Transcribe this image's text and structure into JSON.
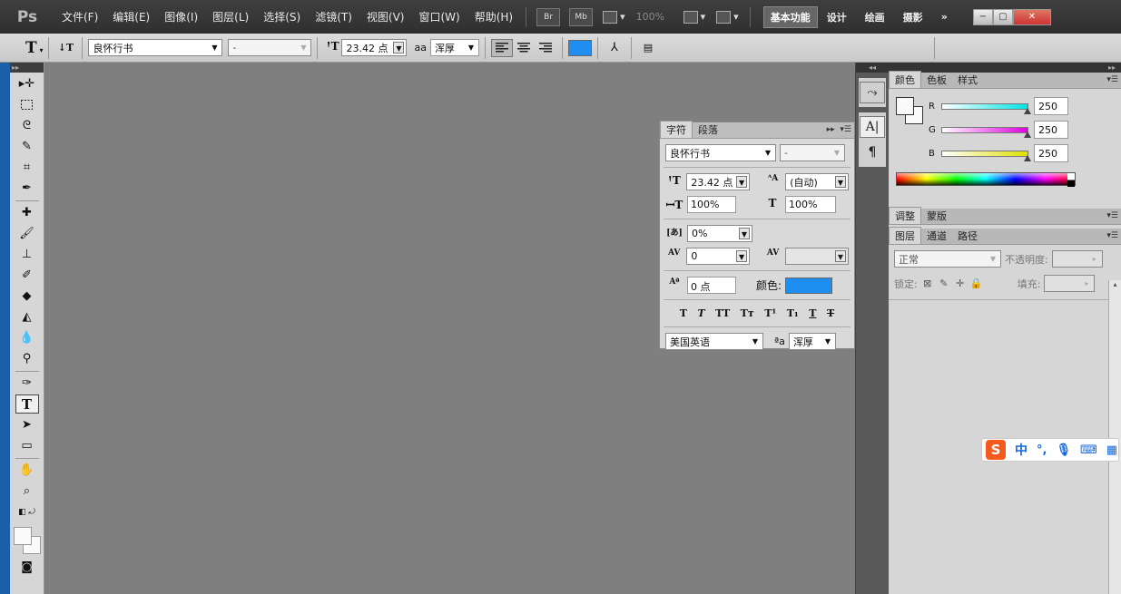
{
  "app": {
    "logo": "Ps"
  },
  "menu": [
    "文件(F)",
    "编辑(E)",
    "图像(I)",
    "图层(L)",
    "选择(S)",
    "滤镜(T)",
    "视图(V)",
    "窗口(W)",
    "帮助(H)"
  ],
  "menubar_tools": {
    "bridge": "Br",
    "minibridge": "Mb",
    "zoom": "100%"
  },
  "workspaces": {
    "active": "基本功能",
    "items": [
      "设计",
      "绘画",
      "摄影"
    ],
    "more": "»"
  },
  "window_controls": {
    "minimize": "−",
    "restore": "▢",
    "close": "✕"
  },
  "options_bar": {
    "font_family": "良怀行书",
    "font_style": "-",
    "font_size": "23.42 点",
    "aa_label": "aa",
    "anti_alias": "浑厚",
    "text_color": "#1e8ff0"
  },
  "character_panel": {
    "tabs": [
      "字符",
      "段落"
    ],
    "font_family": "良怀行书",
    "font_style": "-",
    "font_size": "23.42 点",
    "leading": "(自动)",
    "vertical_scale": "100%",
    "horizontal_scale": "100%",
    "tsume": "0%",
    "tracking": "0",
    "kerning": "",
    "baseline_shift": "0 点",
    "color_label": "颜色:",
    "color": "#1e8ff0",
    "style_buttons": [
      "T",
      "T",
      "TT",
      "Tт",
      "T¹",
      "T₁",
      "T",
      "T"
    ],
    "language": "美国英语",
    "aa_label": "ªa",
    "anti_alias": "浑厚"
  },
  "color_panel": {
    "tabs": [
      "颜色",
      "色板",
      "样式"
    ],
    "channels": [
      {
        "label": "R",
        "value": "250",
        "gradient": [
          "#ffffff",
          "#00e5e5"
        ]
      },
      {
        "label": "G",
        "value": "250",
        "gradient": [
          "#ffffff",
          "#e000e0"
        ]
      },
      {
        "label": "B",
        "value": "250",
        "gradient": [
          "#ffffff",
          "#e0e000"
        ]
      }
    ],
    "channel_level": 0.98,
    "foreground": "#fafafa",
    "background": "#fafafa"
  },
  "adjust_panel": {
    "tabs": [
      "调整",
      "蒙版"
    ]
  },
  "layers_panel": {
    "tabs": [
      "图层",
      "通道",
      "路径"
    ],
    "blend_mode": "正常",
    "opacity_label": "不透明度:",
    "lock_label": "锁定:",
    "fill_label": "填充:"
  },
  "ime": {
    "logo": "S",
    "mode": "中",
    "punct": "°,",
    "mic": "🎙",
    "keyboard": "⌨",
    "grid": "▦"
  }
}
